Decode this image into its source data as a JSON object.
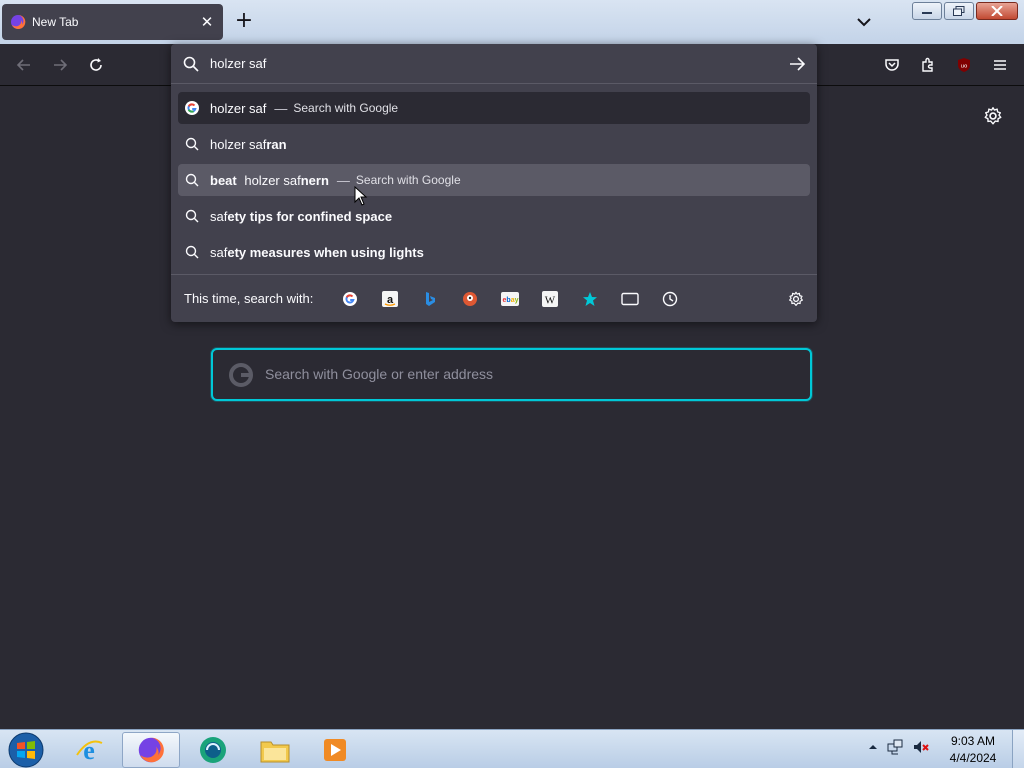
{
  "window": {
    "tab_title": "New Tab"
  },
  "urlbar": {
    "typed": "holzer saf",
    "suggestions": [
      {
        "type": "engine",
        "text_plain": "holzer saf",
        "text_bold": "",
        "prefix_bold": "",
        "action": "Search with Google",
        "selected": true
      },
      {
        "type": "search",
        "prefix_bold": "",
        "text_plain": "holzer saf",
        "text_bold": "ran",
        "action": ""
      },
      {
        "type": "search",
        "prefix_bold": "beat ",
        "text_plain": "holzer saf",
        "text_bold": "nern",
        "action": "Search with Google",
        "hover": true
      },
      {
        "type": "search",
        "prefix_bold": "",
        "text_plain": "saf",
        "text_bold": "ety tips for confined space",
        "action": ""
      },
      {
        "type": "search",
        "prefix_bold": "",
        "text_plain": "saf",
        "text_bold": "ety measures when using lights",
        "action": ""
      }
    ],
    "dash": "—",
    "oneoff_label": "This time, search with:",
    "engines": [
      "google-icon",
      "amazon-icon",
      "bing-icon",
      "duckduckgo-icon",
      "ebay-icon",
      "wikipedia-icon",
      "bookmarks-icon",
      "tabs-icon",
      "history-icon"
    ]
  },
  "newtab": {
    "search_placeholder": "Search with Google or enter address"
  },
  "taskbar": {
    "time": "9:03 AM",
    "date": "4/4/2024"
  },
  "colors": {
    "accent": "#00c8d7",
    "page_bg": "#2b2a33",
    "popup_bg": "#42414d"
  }
}
